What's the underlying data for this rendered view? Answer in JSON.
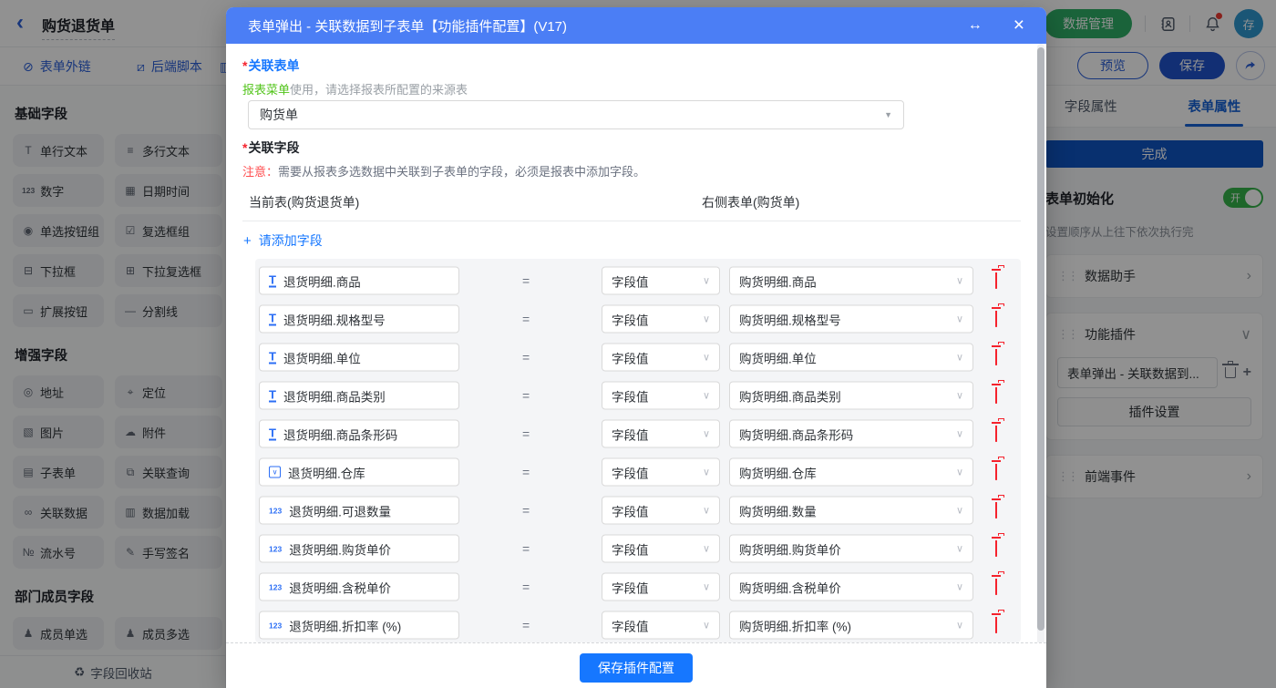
{
  "page": {
    "title": "购货退货单",
    "toolbar_tabs": [
      {
        "label": "表单外链",
        "icon": "link-icon",
        "icon_glyph": "⊘"
      },
      {
        "label": "后端脚本",
        "icon": "script-icon",
        "icon_glyph": "⧄"
      },
      {
        "label": "",
        "icon": "chart-icon-partial",
        "icon_glyph": "▥"
      }
    ],
    "header_right": {
      "data_manage_label": "数据管理",
      "avatar_text": "存"
    },
    "actions": {
      "preview": "预览",
      "save": "保存"
    }
  },
  "sidebar": {
    "sections": [
      {
        "title": "基础字段",
        "items": [
          {
            "label": "单行文本",
            "icon": "text-field-icon",
            "icon_glyph": "T"
          },
          {
            "label": "多行文本",
            "icon": "textarea-icon",
            "icon_glyph": "≡"
          },
          {
            "label": "数字",
            "icon": "number-icon",
            "icon_glyph": "123"
          },
          {
            "label": "日期时间",
            "icon": "calendar-icon",
            "icon_glyph": "▦"
          },
          {
            "label": "单选按钮组",
            "icon": "radio-group-icon",
            "icon_glyph": "◉"
          },
          {
            "label": "复选框组",
            "icon": "checkbox-group-icon",
            "icon_glyph": "☑"
          },
          {
            "label": "下拉框",
            "icon": "select-icon",
            "icon_glyph": "⊟"
          },
          {
            "label": "下拉复选框",
            "icon": "multi-select-icon",
            "icon_glyph": "⊞"
          },
          {
            "label": "扩展按钮",
            "icon": "extend-button-icon",
            "icon_glyph": "▭"
          },
          {
            "label": "分割线",
            "icon": "divider-icon",
            "icon_glyph": "—"
          }
        ]
      },
      {
        "title": "增强字段",
        "items": [
          {
            "label": "地址",
            "icon": "address-pin-icon",
            "icon_glyph": "◎"
          },
          {
            "label": "定位",
            "icon": "locate-icon",
            "icon_glyph": "⌖"
          },
          {
            "label": "图片",
            "icon": "image-icon",
            "icon_glyph": "▧"
          },
          {
            "label": "附件",
            "icon": "attachment-cloud-icon",
            "icon_glyph": "☁"
          },
          {
            "label": "子表单",
            "icon": "subform-icon",
            "icon_glyph": "▤"
          },
          {
            "label": "关联查询",
            "icon": "linked-query-icon",
            "icon_glyph": "⧉"
          },
          {
            "label": "关联数据",
            "icon": "linked-data-icon",
            "icon_glyph": "∞"
          },
          {
            "label": "数据加载",
            "icon": "data-load-icon",
            "icon_glyph": "▥"
          },
          {
            "label": "流水号",
            "icon": "serial-number-icon",
            "icon_glyph": "№"
          },
          {
            "label": "手写签名",
            "icon": "signature-icon",
            "icon_glyph": "✎"
          }
        ]
      },
      {
        "title": "部门成员字段",
        "items": [
          {
            "label": "成员单选",
            "icon": "member-single-icon",
            "icon_glyph": "♟"
          },
          {
            "label": "成员多选",
            "icon": "member-multi-icon",
            "icon_glyph": "♟"
          }
        ]
      }
    ],
    "footer_label": "字段回收站",
    "footer_icon_glyph": "♻"
  },
  "right_panel": {
    "tabs": [
      {
        "label": "字段属性",
        "active": false
      },
      {
        "label": "表单属性",
        "active": true
      }
    ],
    "done_button": "完成",
    "form_init": {
      "label": "表单初始化",
      "toggle_state": "开",
      "desc": "设置顺序从上往下依次执行完"
    },
    "cards": {
      "data_helper": "数据助手",
      "plugins": "功能插件",
      "plugin_item": "表单弹出 - 关联数据到...",
      "plugin_settings_button": "插件设置",
      "front_events": "前端事件"
    }
  },
  "modal": {
    "title": "表单弹出 - 关联数据到子表单【功能插件配置】(V17)",
    "required_mark": "*",
    "related_form": {
      "label": "关联表单",
      "helper_highlight": "报表菜单",
      "helper_rest": "使用，请选择报表所配置的来源表",
      "value": "购货单"
    },
    "related_fields": {
      "label": "关联字段",
      "note_label": "注意：",
      "note_text": "需要从报表多选数据中关联到子表单的字段，必须是报表中添加字段。",
      "left_header": "当前表(购货退货单)",
      "right_header": "右侧表单(购货单)",
      "add_link": "请添加字段",
      "plus": "+"
    },
    "equals_sign": "=",
    "rows": [
      {
        "icon": "text-input-icon",
        "left": "退货明细.商品",
        "mid": "字段值",
        "right": "购货明细.商品"
      },
      {
        "icon": "text-input-icon",
        "left": "退货明细.规格型号",
        "mid": "字段值",
        "right": "购货明细.规格型号"
      },
      {
        "icon": "text-input-icon",
        "left": "退货明细.单位",
        "mid": "字段值",
        "right": "购货明细.单位"
      },
      {
        "icon": "text-input-icon",
        "left": "退货明细.商品类别",
        "mid": "字段值",
        "right": "购货明细.商品类别"
      },
      {
        "icon": "text-input-icon",
        "left": "退货明细.商品条形码",
        "mid": "字段值",
        "right": "购货明细.商品条形码"
      },
      {
        "icon": "select-field-icon",
        "left": "退货明细.仓库",
        "mid": "字段值",
        "right": "购货明细.仓库"
      },
      {
        "icon": "number-field-icon",
        "left": "退货明细.可退数量",
        "mid": "字段值",
        "right": "购货明细.数量"
      },
      {
        "icon": "number-field-icon",
        "left": "退货明细.购货单价",
        "mid": "字段值",
        "right": "购货明细.购货单价"
      },
      {
        "icon": "number-field-icon",
        "left": "退货明细.含税单价",
        "mid": "字段值",
        "right": "购货明细.含税单价"
      },
      {
        "icon": "number-field-icon",
        "left": "退货明细.折扣率 (%)",
        "mid": "字段值",
        "right": "购货明细.折扣率 (%)"
      }
    ],
    "footer_button": "保存插件配置"
  },
  "colors": {
    "modal_header": "#4b7ef5",
    "primary_blue": "#1677ff",
    "dark_blue_button": "#0f55c4",
    "link_blue": "#2b5fd9",
    "green_button": "#2fae67",
    "toggle_green": "#35b34a",
    "danger_red": "#f5222d",
    "helper_green": "#52c41a"
  }
}
